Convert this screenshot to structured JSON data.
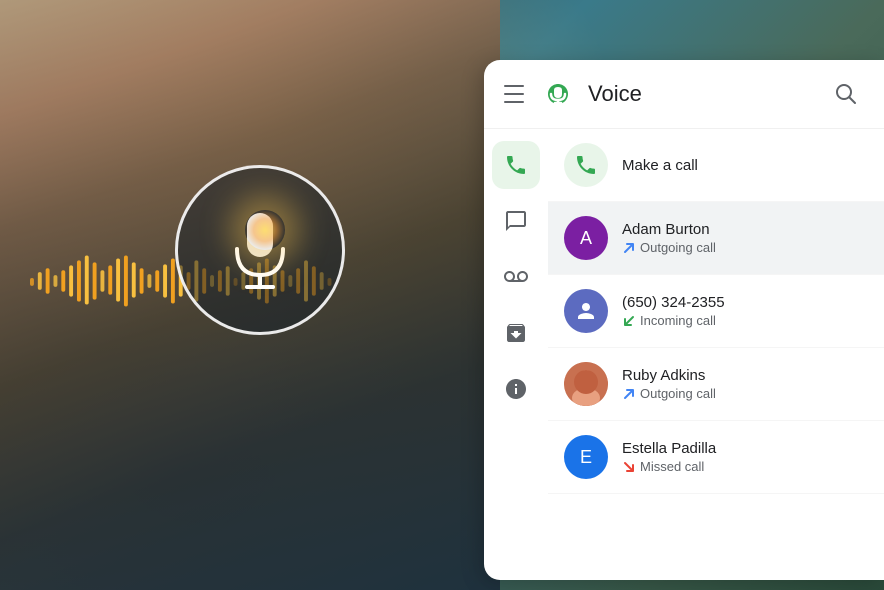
{
  "background": {
    "description": "Person holding phone with voice AI visualization"
  },
  "panel": {
    "title": "Voice",
    "header": {
      "hamburger_label": "Menu",
      "search_label": "Search"
    },
    "sidebar": {
      "items": [
        {
          "name": "calls",
          "label": "Calls",
          "active": true
        },
        {
          "name": "messages",
          "label": "Messages",
          "active": false
        },
        {
          "name": "voicemail",
          "label": "Voicemail",
          "active": false
        },
        {
          "name": "archive",
          "label": "Archive",
          "active": false
        },
        {
          "name": "info",
          "label": "Info",
          "active": false
        }
      ]
    },
    "call_list": {
      "make_call": {
        "label": "Make a call"
      },
      "items": [
        {
          "id": 1,
          "name": "Adam Burton",
          "status": "Outgoing call",
          "status_type": "outgoing",
          "avatar_text": "A",
          "avatar_color": "#7b1fa2",
          "highlighted": true
        },
        {
          "id": 2,
          "name": "(650) 324-2355",
          "status": "Incoming call",
          "status_type": "incoming",
          "avatar_text": "",
          "avatar_color": "#5c6bc0",
          "is_generic": true
        },
        {
          "id": 3,
          "name": "Ruby Adkins",
          "status": "Outgoing call",
          "status_type": "outgoing",
          "avatar_text": "",
          "avatar_color": "",
          "is_photo": true
        },
        {
          "id": 4,
          "name": "Estella Padilla",
          "status": "Missed call",
          "status_type": "missed",
          "avatar_text": "E",
          "avatar_color": "#1a73e8"
        }
      ]
    }
  }
}
